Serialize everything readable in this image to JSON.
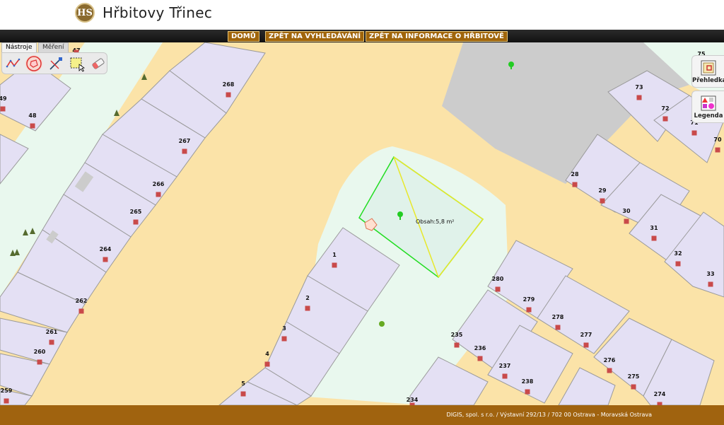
{
  "header": {
    "logo_text": "HS",
    "title": "Hřbitovy Třinec"
  },
  "nav": [
    {
      "label": "DOMŮ"
    },
    {
      "label": "ZPĚT NA VYHLEDÁVÁNÍ"
    },
    {
      "label": "ZPĚT NA INFORMACE O HŘBITOVĚ"
    }
  ],
  "toolpanel": {
    "tabs": [
      {
        "label": "Nástroje",
        "active": true
      },
      {
        "label": "Měření",
        "active": false
      }
    ],
    "tools": [
      {
        "icon": "polyline-measure-icon"
      },
      {
        "icon": "polygon-area-icon"
      },
      {
        "icon": "ruler-edit-icon"
      },
      {
        "icon": "select-rectangle-icon"
      },
      {
        "icon": "eraser-icon"
      }
    ]
  },
  "side_buttons": [
    {
      "label": "Přehledka",
      "icon": "overview-map-icon"
    },
    {
      "label": "Legenda",
      "icon": "legend-icon"
    }
  ],
  "map": {
    "area_label": "Obsah:5,8 m²",
    "plot_labels": [
      "47",
      "49",
      "48",
      "268",
      "267",
      "266",
      "265",
      "264",
      "262",
      "261",
      "260",
      "259",
      "1",
      "2",
      "3",
      "4",
      "5",
      "75",
      "73",
      "72",
      "71",
      "70",
      "28",
      "29",
      "30",
      "31",
      "32",
      "33",
      "280",
      "279",
      "278",
      "277",
      "276",
      "275",
      "274",
      "235",
      "236",
      "237",
      "238",
      "234"
    ]
  },
  "footer": {
    "text": "DIGIS, spol. s r.o. / Výstavní 292/13 / 702 00 Ostrava - Moravská Ostrava"
  },
  "colors": {
    "road": "#fbe3a8",
    "plot": "#e4e0f4",
    "path": "#e9f8ee",
    "building": "#cccccc",
    "footer": "#a0630f",
    "accent": "#a0650b",
    "measure_green": "#22dd22",
    "measure_yellow": "#e8e82a"
  }
}
